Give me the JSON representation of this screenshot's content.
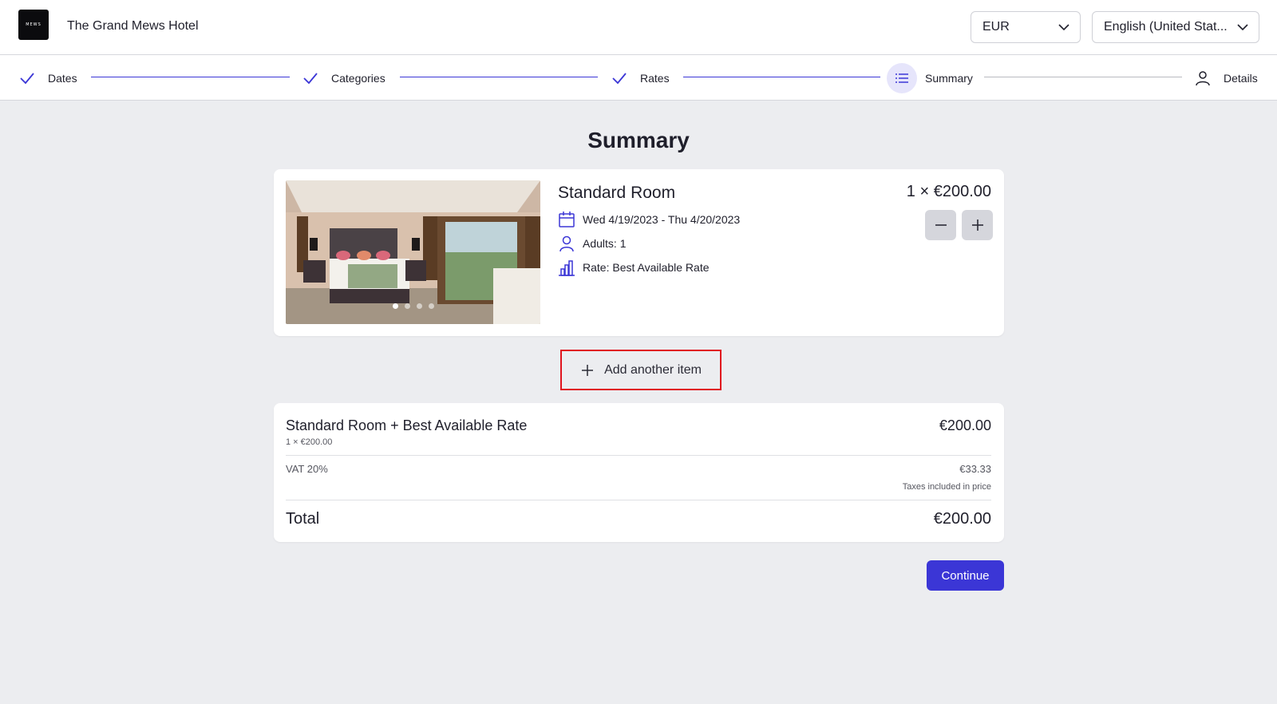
{
  "header": {
    "logo_text": "MEWS",
    "hotel_name": "The Grand Mews Hotel",
    "currency": "EUR",
    "language": "English (United Stat..."
  },
  "stepper": {
    "steps": [
      {
        "label": "Dates",
        "state": "done",
        "icon": "check-icon"
      },
      {
        "label": "Categories",
        "state": "done",
        "icon": "check-icon"
      },
      {
        "label": "Rates",
        "state": "done",
        "icon": "check-icon"
      },
      {
        "label": "Summary",
        "state": "current",
        "icon": "list-icon"
      },
      {
        "label": "Details",
        "state": "todo",
        "icon": "person-icon"
      }
    ]
  },
  "page": {
    "title": "Summary"
  },
  "room": {
    "name": "Standard Room",
    "price": "1 × €200.00",
    "dates": "Wed 4/19/2023 - Thu 4/20/2023",
    "adults": "Adults: 1",
    "rate": "Rate: Best Available Rate",
    "photo_count": 4,
    "active_photo": 1
  },
  "actions": {
    "add_item": "Add another item",
    "continue": "Continue"
  },
  "summary": {
    "item_title": "Standard Room + Best Available Rate",
    "item_sub": "1 × €200.00",
    "item_price": "€200.00",
    "vat_label": "VAT 20%",
    "vat_value": "€33.33",
    "tax_note": "Taxes included in price",
    "total_label": "Total",
    "total_value": "€200.00"
  },
  "colors": {
    "accent": "#3b36d6",
    "highlight_border": "#e0141e",
    "background": "#ecedf0"
  }
}
